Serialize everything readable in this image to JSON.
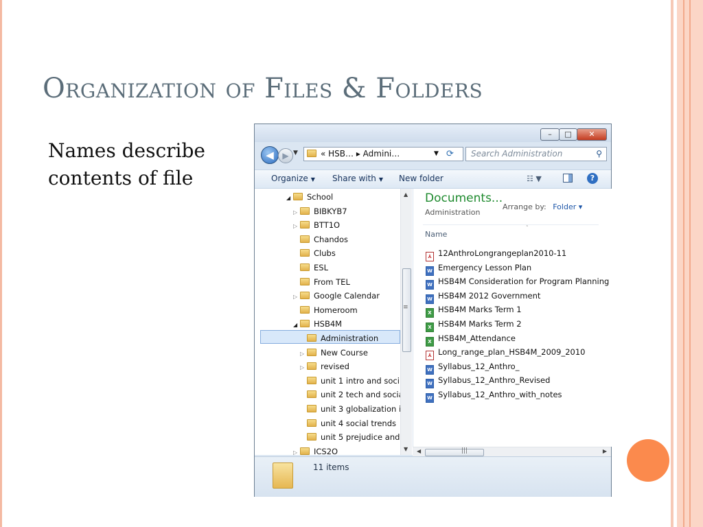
{
  "slide": {
    "title": "Organization of Files & Folders",
    "body": "Names describe contents of file"
  },
  "explorer": {
    "window_buttons": {
      "minimize": "–",
      "maximize": "□",
      "close": "✕"
    },
    "address": {
      "crumbs": "«  HSB…  ▸  Admini…"
    },
    "search": {
      "placeholder": "Search Administration"
    },
    "toolbar": {
      "organize": "Organize",
      "share_with": "Share with",
      "new_folder": "New folder"
    },
    "nav_items": [
      {
        "label": "School",
        "arrow": "◢",
        "level": 0
      },
      {
        "label": "BIBKYB7",
        "arrow": "▷",
        "level": 1
      },
      {
        "label": "BTT1O",
        "arrow": "▷",
        "level": 1
      },
      {
        "label": "Chandos",
        "arrow": "",
        "level": 1
      },
      {
        "label": "Clubs",
        "arrow": "",
        "level": 1
      },
      {
        "label": "ESL",
        "arrow": "",
        "level": 1
      },
      {
        "label": "From TEL",
        "arrow": "",
        "level": 1
      },
      {
        "label": "Google Calendar",
        "arrow": "▷",
        "level": 1
      },
      {
        "label": "Homeroom",
        "arrow": "",
        "level": 1
      },
      {
        "label": "HSB4M",
        "arrow": "◢",
        "level": 1
      },
      {
        "label": "Administration",
        "arrow": "",
        "level": 2
      },
      {
        "label": "New Course",
        "arrow": "▷",
        "level": 2
      },
      {
        "label": "revised",
        "arrow": "▷",
        "level": 2
      },
      {
        "label": "unit 1 intro and soci",
        "arrow": "",
        "level": 2
      },
      {
        "label": "unit 2 tech and socia",
        "arrow": "",
        "level": 2
      },
      {
        "label": "unit 3 globalization i",
        "arrow": "",
        "level": 2
      },
      {
        "label": "unit 4 social trends",
        "arrow": "",
        "level": 2
      },
      {
        "label": "unit 5 prejudice and",
        "arrow": "",
        "level": 2
      },
      {
        "label": "ICS2O",
        "arrow": "▷",
        "level": 1
      }
    ],
    "library": {
      "title": "Documents...",
      "subtitle": "Administration",
      "arrange_by": "Arrange by:",
      "arrange_value": "Folder"
    },
    "column_header": "Name",
    "files": [
      {
        "name": "12AnthroLongrangeplan2010-11",
        "type": "pdf"
      },
      {
        "name": "Emergency Lesson Plan",
        "type": "word"
      },
      {
        "name": "HSB4M  Consideration for Program Planning",
        "type": "word"
      },
      {
        "name": "HSB4M 2012 Government",
        "type": "word"
      },
      {
        "name": "HSB4M Marks Term 1",
        "type": "excel"
      },
      {
        "name": "HSB4M Marks Term 2",
        "type": "excel"
      },
      {
        "name": "HSB4M_Attendance",
        "type": "excel"
      },
      {
        "name": "Long_range_plan_HSB4M_2009_2010",
        "type": "pdf"
      },
      {
        "name": "Syllabus_12_Anthro_",
        "type": "word"
      },
      {
        "name": "Syllabus_12_Anthro_Revised",
        "type": "word"
      },
      {
        "name": "Syllabus_12_Anthro_with_notes",
        "type": "word"
      }
    ],
    "status": {
      "count": "11 items"
    },
    "colors": {
      "library_title": "#1e8a2e",
      "selected": "#d8e8fa",
      "accent_circle": "#fb8a4d"
    }
  }
}
